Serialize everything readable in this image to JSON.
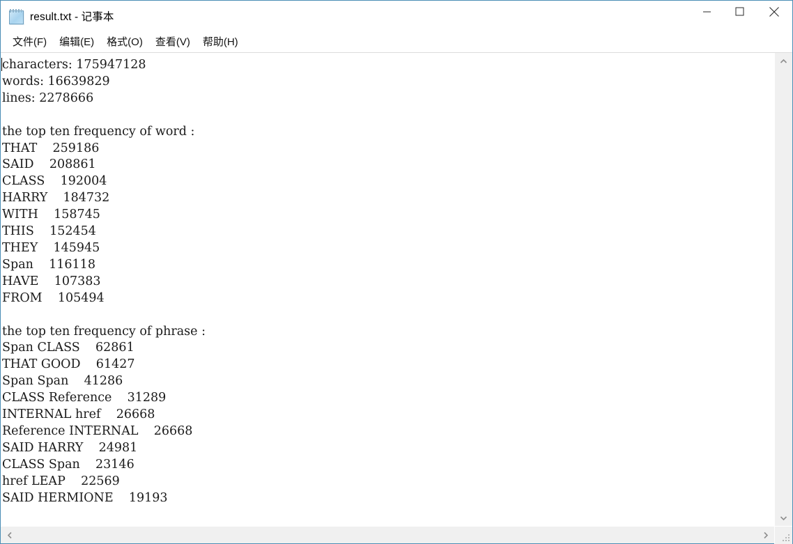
{
  "window": {
    "title": "result.txt - 记事本",
    "icon": "notepad-icon",
    "border_color": "#4a8db5",
    "background": "#ffffff"
  },
  "caption_buttons": {
    "minimize_label": "最小化",
    "maximize_label": "最大化",
    "close_label": "关闭"
  },
  "menubar": {
    "items": [
      {
        "label": "文件(F)"
      },
      {
        "label": "编辑(E)"
      },
      {
        "label": "格式(O)"
      },
      {
        "label": "查看(V)"
      },
      {
        "label": "帮助(H)"
      }
    ]
  },
  "document": {
    "filename": "result.txt",
    "summary": {
      "characters_label": "characters:",
      "characters": "175947128",
      "words_label": "words:",
      "words": "16639829",
      "lines_label": "lines:",
      "lines": "2278666"
    },
    "word_section_heading": "the top ten frequency of word :",
    "top_words": [
      {
        "word": "THAT",
        "count": "259186"
      },
      {
        "word": "SAID",
        "count": "208861"
      },
      {
        "word": "CLASS",
        "count": "192004"
      },
      {
        "word": "HARRY",
        "count": "184732"
      },
      {
        "word": "WITH",
        "count": "158745"
      },
      {
        "word": "THIS",
        "count": "152454"
      },
      {
        "word": "THEY",
        "count": "145945"
      },
      {
        "word": "Span",
        "count": "116118"
      },
      {
        "word": "HAVE",
        "count": "107383"
      },
      {
        "word": "FROM",
        "count": "105494"
      }
    ],
    "phrase_section_heading": "the top ten frequency of phrase :",
    "top_phrases": [
      {
        "phrase": "Span CLASS",
        "count": "62861"
      },
      {
        "phrase": "THAT GOOD",
        "count": "61427"
      },
      {
        "phrase": "Span Span",
        "count": "41286"
      },
      {
        "phrase": "CLASS Reference",
        "count": "31289"
      },
      {
        "phrase": "INTERNAL href",
        "count": "26668"
      },
      {
        "phrase": "Reference INTERNAL",
        "count": "26668"
      },
      {
        "phrase": "SAID HARRY",
        "count": "24981"
      },
      {
        "phrase": "CLASS Span",
        "count": "23146"
      },
      {
        "phrase": "href LEAP",
        "count": "22569"
      },
      {
        "phrase": "SAID HERMIONE",
        "count": "19193"
      }
    ],
    "body_text": "characters: 175947128\nwords: 16639829\nlines: 2278666\n\nthe top ten frequency of word :\nTHAT    259186\nSAID    208861\nCLASS    192004\nHARRY    184732\nWITH    158745\nTHIS    152454\nTHEY    145945\nSpan    116118\nHAVE    107383\nFROM    105494\n\nthe top ten frequency of phrase :\nSpan CLASS    62861\nTHAT GOOD    61427\nSpan Span    41286\nCLASS Reference    31289\nINTERNAL href    26668\nReference INTERNAL    26668\nSAID HARRY    24981\nCLASS Span    23146\nhref LEAP    22569\nSAID HERMIONE    19193"
  },
  "scrollbars": {
    "vertical": {
      "up_icon": "chevron-up-icon",
      "down_icon": "chevron-down-icon"
    },
    "horizontal": {
      "left_icon": "chevron-left-icon",
      "right_icon": "chevron-right-icon"
    },
    "resize_grip_icon": "resize-grip-icon"
  }
}
